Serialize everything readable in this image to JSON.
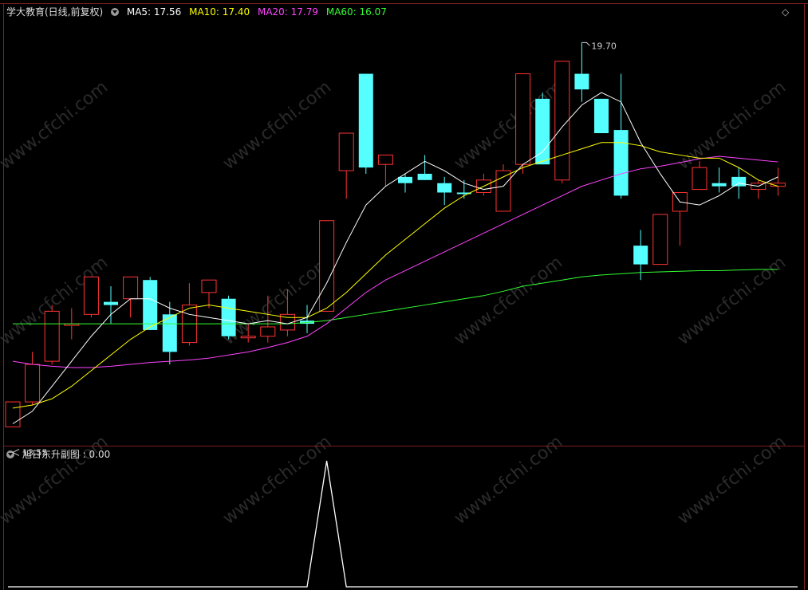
{
  "main_panel": {
    "title": "学大教育(日线,前复权)",
    "ma_readouts": [
      {
        "label": "MA5: 17.56",
        "color": "#ffffff"
      },
      {
        "label": "MA10: 17.40",
        "color": "#ffff00"
      },
      {
        "label": "MA20: 17.79",
        "color": "#ff44ff"
      },
      {
        "label": "MA60: 16.07",
        "color": "#33ff33"
      }
    ],
    "high_marker": "19.70",
    "low_marker": "13.55",
    "diamond_icon": "diamond-icon"
  },
  "sub_panel": {
    "title": "旭日东升副图 : 0.00"
  },
  "watermark": "www.cfchi.com",
  "colors": {
    "up": "#ff3333",
    "down": "#55ffff",
    "ma5": "#ffffff",
    "ma10": "#ffff00",
    "ma20": "#ff44ff",
    "ma60": "#33ff33",
    "frame": "#8b1a1a"
  },
  "chart_data": [
    {
      "type": "candlestick",
      "title": "学大教育(日线,前复权)",
      "ylim": [
        13.3,
        20.1
      ],
      "candles": [
        {
          "o": 13.55,
          "h": 13.85,
          "l": 13.55,
          "c": 13.95
        },
        {
          "o": 13.95,
          "h": 14.75,
          "l": 13.9,
          "c": 14.55
        },
        {
          "o": 14.6,
          "h": 15.5,
          "l": 14.55,
          "c": 15.4
        },
        {
          "o": 15.2,
          "h": 15.45,
          "l": 14.95,
          "c": 15.2
        },
        {
          "o": 15.35,
          "h": 15.8,
          "l": 15.3,
          "c": 15.95
        },
        {
          "o": 15.55,
          "h": 15.8,
          "l": 15.2,
          "c": 15.5
        },
        {
          "o": 15.6,
          "h": 15.9,
          "l": 15.3,
          "c": 15.95
        },
        {
          "o": 15.9,
          "h": 15.95,
          "l": 15.1,
          "c": 15.1
        },
        {
          "o": 15.35,
          "h": 15.55,
          "l": 14.55,
          "c": 14.75
        },
        {
          "o": 14.9,
          "h": 15.85,
          "l": 14.85,
          "c": 15.5
        },
        {
          "o": 15.7,
          "h": 15.85,
          "l": 15.45,
          "c": 15.9
        },
        {
          "o": 15.6,
          "h": 15.65,
          "l": 14.95,
          "c": 15.0
        },
        {
          "o": 15.0,
          "h": 15.2,
          "l": 14.9,
          "c": 15.0
        },
        {
          "o": 15.0,
          "h": 15.65,
          "l": 14.9,
          "c": 15.15
        },
        {
          "o": 15.1,
          "h": 15.75,
          "l": 15.0,
          "c": 15.35
        },
        {
          "o": 15.25,
          "h": 15.5,
          "l": 15.05,
          "c": 15.2
        },
        {
          "o": 15.4,
          "h": 16.85,
          "l": 15.4,
          "c": 16.85
        },
        {
          "o": 17.65,
          "h": 18.25,
          "l": 17.2,
          "c": 18.25
        },
        {
          "o": 19.2,
          "h": 19.2,
          "l": 17.6,
          "c": 17.7
        },
        {
          "o": 17.75,
          "h": 17.85,
          "l": 17.4,
          "c": 17.9
        },
        {
          "o": 17.55,
          "h": 17.6,
          "l": 17.3,
          "c": 17.45
        },
        {
          "o": 17.6,
          "h": 17.9,
          "l": 17.5,
          "c": 17.5
        },
        {
          "o": 17.45,
          "h": 17.55,
          "l": 17.1,
          "c": 17.3
        },
        {
          "o": 17.3,
          "h": 17.5,
          "l": 17.2,
          "c": 17.28
        },
        {
          "o": 17.3,
          "h": 17.6,
          "l": 17.25,
          "c": 17.5
        },
        {
          "o": 17.0,
          "h": 17.75,
          "l": 17.0,
          "c": 17.65
        },
        {
          "o": 17.75,
          "h": 19.2,
          "l": 17.6,
          "c": 19.2
        },
        {
          "o": 18.8,
          "h": 18.9,
          "l": 17.75,
          "c": 17.75
        },
        {
          "o": 17.5,
          "h": 19.4,
          "l": 17.45,
          "c": 19.4
        },
        {
          "o": 19.2,
          "h": 19.7,
          "l": 18.75,
          "c": 18.95
        },
        {
          "o": 18.8,
          "h": 18.8,
          "l": 18.25,
          "c": 18.25
        },
        {
          "o": 18.3,
          "h": 19.2,
          "l": 17.2,
          "c": 17.25
        },
        {
          "o": 16.45,
          "h": 16.7,
          "l": 15.9,
          "c": 16.15
        },
        {
          "o": 16.15,
          "h": 16.95,
          "l": 16.15,
          "c": 16.95
        },
        {
          "o": 17.0,
          "h": 17.25,
          "l": 16.45,
          "c": 17.3
        },
        {
          "o": 17.35,
          "h": 17.8,
          "l": 17.35,
          "c": 17.7
        },
        {
          "o": 17.45,
          "h": 17.7,
          "l": 17.3,
          "c": 17.4
        },
        {
          "o": 17.55,
          "h": 17.7,
          "l": 17.2,
          "c": 17.4
        },
        {
          "o": 17.35,
          "h": 17.5,
          "l": 17.2,
          "c": 17.45
        },
        {
          "o": 17.4,
          "h": 17.7,
          "l": 17.25,
          "c": 17.45
        }
      ],
      "ma5": [
        13.6,
        13.8,
        14.2,
        14.6,
        15.0,
        15.35,
        15.6,
        15.6,
        15.45,
        15.35,
        15.3,
        15.25,
        15.2,
        15.25,
        15.2,
        15.3,
        15.85,
        16.5,
        17.1,
        17.4,
        17.6,
        17.8,
        17.65,
        17.45,
        17.35,
        17.4,
        17.75,
        17.95,
        18.35,
        18.7,
        18.9,
        18.75,
        18.1,
        17.6,
        17.15,
        17.1,
        17.25,
        17.45,
        17.4,
        17.55
      ],
      "ma10": [
        13.85,
        13.9,
        14.0,
        14.2,
        14.45,
        14.7,
        14.95,
        15.15,
        15.3,
        15.45,
        15.5,
        15.45,
        15.4,
        15.35,
        15.3,
        15.3,
        15.45,
        15.7,
        16.0,
        16.3,
        16.55,
        16.8,
        17.05,
        17.25,
        17.4,
        17.55,
        17.7,
        17.8,
        17.9,
        18.0,
        18.1,
        18.1,
        18.05,
        17.95,
        17.9,
        17.85,
        17.85,
        17.7,
        17.5,
        17.4
      ],
      "ma20": [
        14.6,
        14.55,
        14.52,
        14.5,
        14.5,
        14.52,
        14.55,
        14.58,
        14.6,
        14.62,
        14.65,
        14.7,
        14.75,
        14.82,
        14.9,
        15.0,
        15.2,
        15.45,
        15.7,
        15.9,
        16.05,
        16.2,
        16.35,
        16.5,
        16.65,
        16.8,
        16.95,
        17.1,
        17.25,
        17.4,
        17.5,
        17.6,
        17.68,
        17.72,
        17.78,
        17.84,
        17.88,
        17.85,
        17.82,
        17.79
      ],
      "ma60": [
        15.2,
        15.2,
        15.2,
        15.2,
        15.2,
        15.2,
        15.2,
        15.2,
        15.2,
        15.2,
        15.2,
        15.2,
        15.2,
        15.2,
        15.2,
        15.22,
        15.25,
        15.3,
        15.35,
        15.4,
        15.45,
        15.5,
        15.55,
        15.6,
        15.65,
        15.72,
        15.8,
        15.85,
        15.9,
        15.95,
        15.98,
        16.0,
        16.02,
        16.03,
        16.04,
        16.05,
        16.05,
        16.06,
        16.07,
        16.07
      ],
      "annotations": [
        "19.70",
        "13.55"
      ]
    },
    {
      "type": "line",
      "title": "旭日东升副图",
      "ylim": [
        0,
        1
      ],
      "values": [
        0,
        0,
        0,
        0,
        0,
        0,
        0,
        0,
        0,
        0,
        0,
        0,
        0,
        0,
        0,
        0,
        1,
        0,
        0,
        0,
        0,
        0,
        0,
        0,
        0,
        0,
        0,
        0,
        0,
        0,
        0,
        0,
        0,
        0,
        0,
        0,
        0,
        0,
        0,
        0
      ]
    }
  ]
}
